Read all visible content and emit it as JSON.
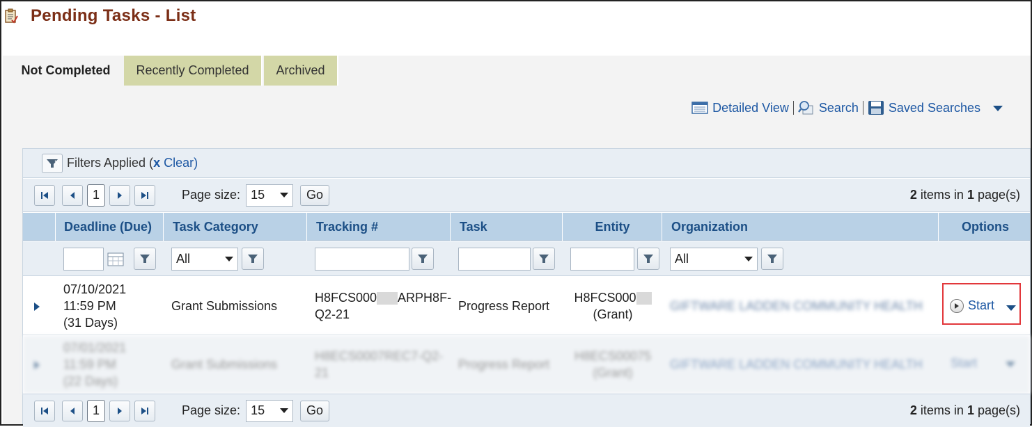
{
  "page": {
    "title": "Pending Tasks - List"
  },
  "tabs": [
    {
      "label": "Not Completed",
      "active": true
    },
    {
      "label": "Recently Completed",
      "active": false
    },
    {
      "label": "Archived",
      "active": false
    }
  ],
  "toolbar": {
    "detailed_view": "Detailed View",
    "search": "Search",
    "saved_searches": "Saved Searches"
  },
  "filters": {
    "applied_label": "Filters Applied (",
    "clear_label": "Clear)",
    "clear_x": "x"
  },
  "pager": {
    "current_page": "1",
    "page_size_label": "Page size:",
    "page_size_value": "15",
    "go_label": "Go",
    "items_count": "2",
    "items_text": " items in ",
    "pages_count": "1",
    "pages_text": " page(s)"
  },
  "columns": {
    "deadline": "Deadline (Due)",
    "task_category": "Task Category",
    "tracking": "Tracking #",
    "task": "Task",
    "entity": "Entity",
    "organization": "Organization",
    "options": "Options"
  },
  "column_filters": {
    "task_category_value": "All",
    "organization_value": "All"
  },
  "rows": [
    {
      "deadline_date": "07/10/2021",
      "deadline_time": "11:59 PM",
      "deadline_days": "(31 Days)",
      "task_category": "Grant Submissions",
      "tracking_prefix": "H8FCS000",
      "tracking_suffix": "ARPH8F-",
      "tracking_line2": "Q2-21",
      "task": "Progress Report",
      "entity_line1": "H8FCS000",
      "entity_line2": "(Grant)",
      "organization": "GIFTWARE LADDEN COMMUNITY HEALTH",
      "option_label": "Start"
    },
    {
      "deadline_date": "07/01/2021",
      "deadline_time": "11:59 PM",
      "deadline_days": "(22 Days)",
      "task_category": "Grant Submissions",
      "tracking_line1": "H8ECS0007REC7-Q2-",
      "tracking_line2": "21",
      "task": "Progress Report",
      "entity_line1": "H8ECS00075",
      "entity_line2": "(Grant)",
      "organization": "GIFTWARE LADDEN COMMUNITY HEALTH",
      "option_label": "Start"
    }
  ],
  "colors": {
    "title": "#7b2e16",
    "link": "#1c57a3",
    "header_bg": "#b9d1e6",
    "tab_inactive_bg": "#d3d7a7",
    "highlight_box": "#e2373b"
  }
}
